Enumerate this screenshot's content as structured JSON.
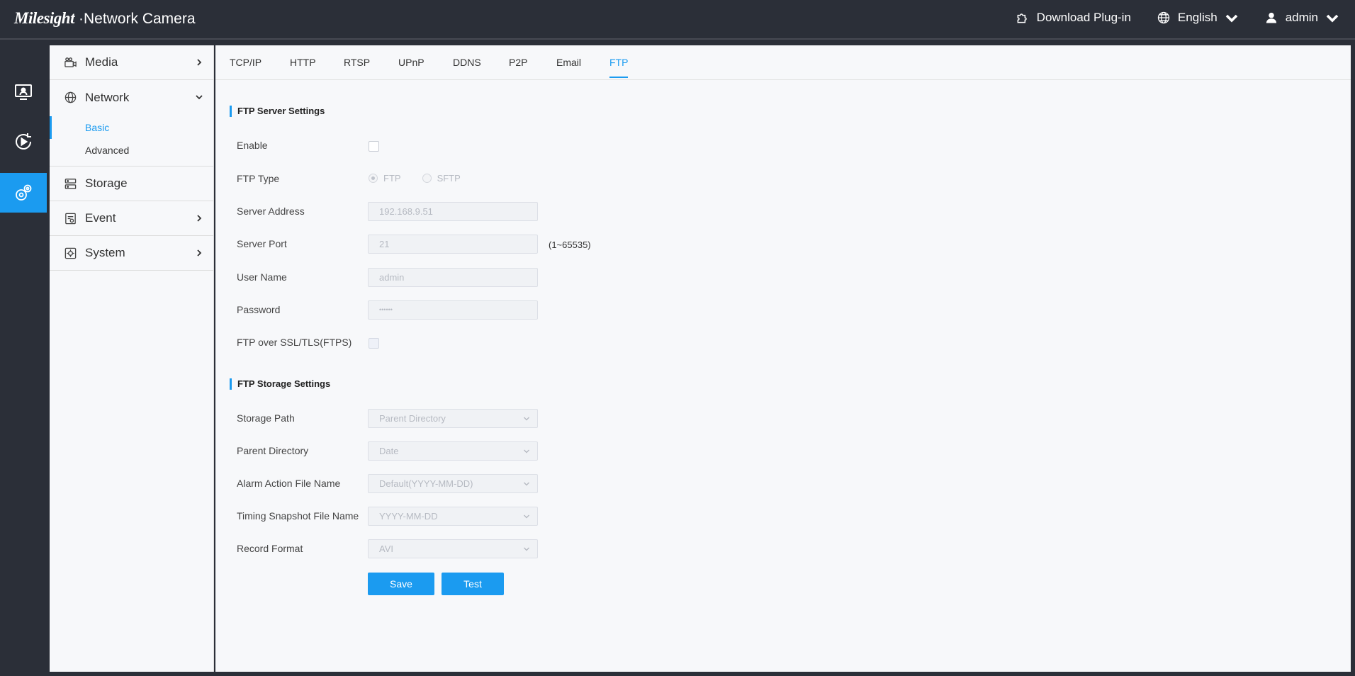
{
  "header": {
    "logo": "Milesight",
    "title": "Network Camera",
    "download_plugin": "Download Plug-in",
    "language": "English",
    "user": "admin"
  },
  "rail": {
    "items": [
      {
        "name": "live-view",
        "icon": "monitor-icon"
      },
      {
        "name": "playback",
        "icon": "playback-icon"
      },
      {
        "name": "settings",
        "icon": "settings-icon",
        "active": true
      }
    ]
  },
  "nav": {
    "media": "Media",
    "network": "Network",
    "network_sub": [
      "Basic",
      "Advanced"
    ],
    "storage": "Storage",
    "event": "Event",
    "system": "System"
  },
  "tabs": [
    "TCP/IP",
    "HTTP",
    "RTSP",
    "UPnP",
    "DDNS",
    "P2P",
    "Email",
    "FTP"
  ],
  "active_tab": "FTP",
  "ftp_server": {
    "section_title": "FTP Server Settings",
    "enable_label": "Enable",
    "type_label": "FTP Type",
    "type_options": [
      "FTP",
      "SFTP"
    ],
    "type_selected": "FTP",
    "address_label": "Server Address",
    "address_value": "192.168.9.51",
    "port_label": "Server Port",
    "port_value": "21",
    "port_range": "(1~65535)",
    "username_label": "User Name",
    "username_value": "admin",
    "password_label": "Password",
    "password_value": "••••••",
    "ftps_label": "FTP over SSL/TLS(FTPS)"
  },
  "ftp_storage": {
    "section_title": "FTP Storage Settings",
    "storage_path_label": "Storage Path",
    "storage_path_value": "Parent Directory",
    "parent_dir_label": "Parent Directory",
    "parent_dir_value": "Date",
    "alarm_file_label": "Alarm Action File Name",
    "alarm_file_value": "Default(YYYY-MM-DD)",
    "snapshot_file_label": "Timing Snapshot File Name",
    "snapshot_file_value": "YYYY-MM-DD",
    "record_format_label": "Record Format",
    "record_format_value": "AVI"
  },
  "buttons": {
    "save": "Save",
    "test": "Test"
  },
  "colors": {
    "accent": "#1b9bf0",
    "topbar": "#2b2f38"
  }
}
